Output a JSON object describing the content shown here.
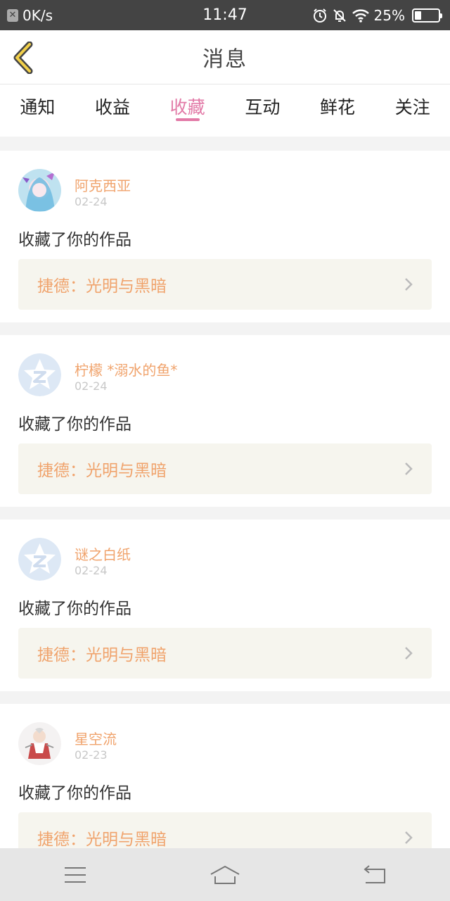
{
  "status_bar": {
    "speed": "0K/s",
    "time": "11:47",
    "battery": "25%",
    "battery_level": 0.25,
    "icons": [
      "sim-off-icon",
      "alarm-icon",
      "mute-bell-icon",
      "wifi-icon",
      "battery-icon"
    ]
  },
  "header": {
    "title": "消息"
  },
  "tabs": [
    {
      "label": "通知",
      "active": false
    },
    {
      "label": "收益",
      "active": false
    },
    {
      "label": "收藏",
      "active": true
    },
    {
      "label": "互动",
      "active": false
    },
    {
      "label": "鲜花",
      "active": false
    },
    {
      "label": "关注",
      "active": false
    }
  ],
  "colors": {
    "accent_pink": "#e27aa7",
    "accent_orange": "#f0a36c",
    "work_bg": "#f6f5ee"
  },
  "messages": [
    {
      "username": "阿克西亚",
      "date": "02-24",
      "action": "收藏了你的作品",
      "work": "捷德：光明与黑暗",
      "avatar": "anime-girl-avatar"
    },
    {
      "username": "柠檬 *溺水的鱼*",
      "date": "02-24",
      "action": "收藏了你的作品",
      "work": "捷德：光明与黑暗",
      "avatar": "default-star-avatar"
    },
    {
      "username": "谜之白纸",
      "date": "02-24",
      "action": "收藏了你的作品",
      "work": "捷德：光明与黑暗",
      "avatar": "default-star-avatar"
    },
    {
      "username": "星空流",
      "date": "02-23",
      "action": "收藏了你的作品",
      "work": "捷德：光明与黑暗",
      "avatar": "anime-character-avatar"
    }
  ],
  "navbar": {
    "icons": [
      "menu-icon",
      "home-icon",
      "back-icon"
    ]
  }
}
